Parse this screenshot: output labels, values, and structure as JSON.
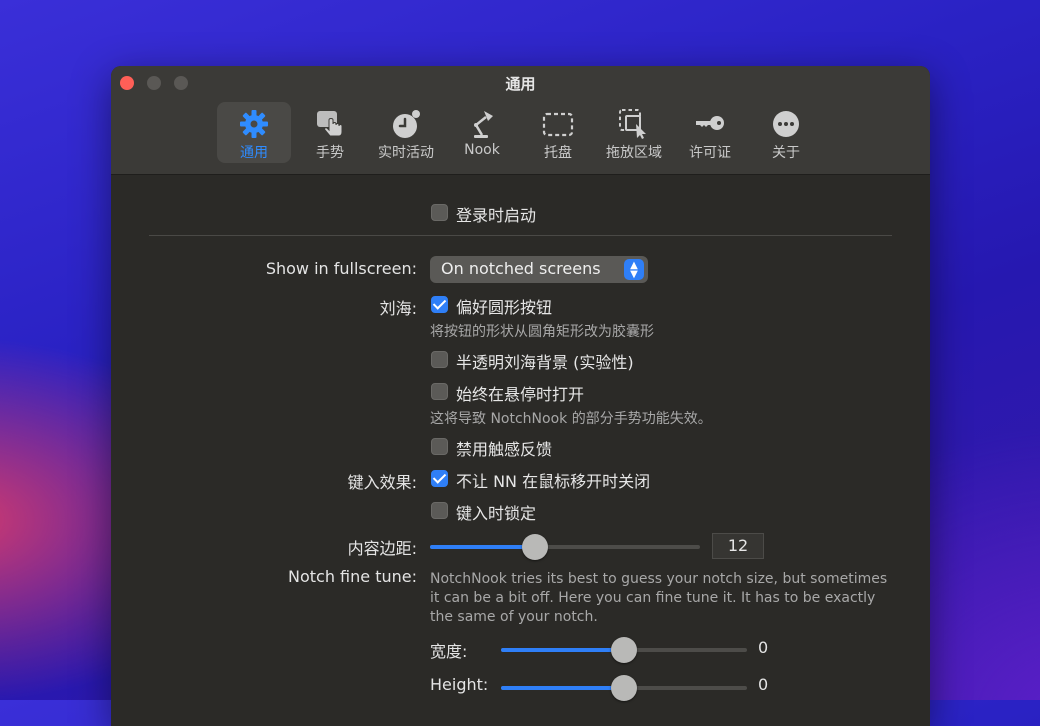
{
  "window": {
    "title": "通用"
  },
  "tabs": [
    {
      "label": "通用",
      "icon": "gear-icon"
    },
    {
      "label": "手势",
      "icon": "hand-pointer-icon"
    },
    {
      "label": "实时活动",
      "icon": "clock-badge-icon"
    },
    {
      "label": "Nook",
      "icon": "desk-lamp-icon"
    },
    {
      "label": "托盘",
      "icon": "dashed-tray-icon"
    },
    {
      "label": "拖放区域",
      "icon": "drop-zone-icon"
    },
    {
      "label": "许可证",
      "icon": "key-icon"
    },
    {
      "label": "关于",
      "icon": "ellipsis-circle-icon"
    }
  ],
  "general": {
    "launch_at_login": {
      "label": "登录时启动",
      "checked": false
    },
    "show_in_fullscreen": {
      "label": "Show in fullscreen:",
      "value": "On notched screens"
    },
    "notch": {
      "label": "刘海:",
      "prefer_round_buttons": {
        "label": "偏好圆形按钮",
        "checked": true,
        "hint": "将按钮的形状从圆角矩形改为胶囊形"
      },
      "translucent_bg": {
        "label": "半透明刘海背景 (实验性)",
        "checked": false
      },
      "always_open_hover": {
        "label": "始终在悬停时打开",
        "checked": false,
        "hint": "这将导致 NotchNook 的部分手势功能失效。"
      },
      "disable_haptics": {
        "label": "禁用触感反馈",
        "checked": false
      }
    },
    "typing": {
      "label": "键入效果:",
      "no_close_on_move": {
        "label": "不让 NN 在鼠标移开时关闭",
        "checked": true
      },
      "lock_while_typing": {
        "label": "键入时锁定",
        "checked": false
      }
    },
    "content_padding": {
      "label": "内容边距:",
      "value": "12"
    },
    "notch_fine_tune": {
      "label": "Notch fine tune:",
      "description": "NotchNook tries its best to guess your notch size, but sometimes it can be a bit off. Here you can fine tune it. It has to be exactly the same of your notch.",
      "width": {
        "label": "宽度:",
        "value": "0"
      },
      "height": {
        "label": "Height:",
        "value": "0"
      }
    }
  },
  "colors": {
    "accent": "#2f7ff7",
    "window_bg": "#2b2a27",
    "titlebar_bg": "#3b3a37"
  }
}
